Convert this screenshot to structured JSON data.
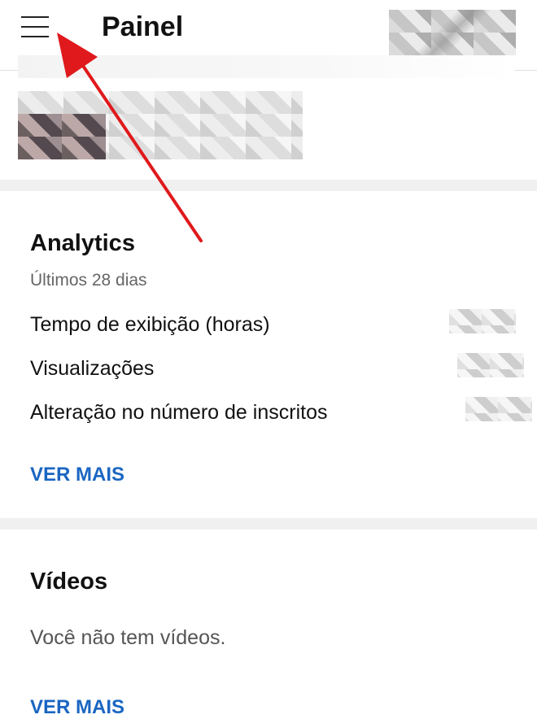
{
  "header": {
    "title": "Painel",
    "menu_icon": "hamburger-menu-icon"
  },
  "analytics": {
    "title": "Analytics",
    "period": "Últimos 28 dias",
    "metrics": [
      {
        "label": "Tempo de exibição (horas)"
      },
      {
        "label": "Visualizações"
      },
      {
        "label": "Alteração no número de inscritos"
      }
    ],
    "see_more": "VER MAIS"
  },
  "videos": {
    "title": "Vídeos",
    "empty_message": "Você não tem vídeos.",
    "see_more": "VER MAIS"
  },
  "colors": {
    "accent_link": "#1a66c2",
    "annotation_arrow": "#e0191c",
    "divider": "#f0f0f0"
  }
}
